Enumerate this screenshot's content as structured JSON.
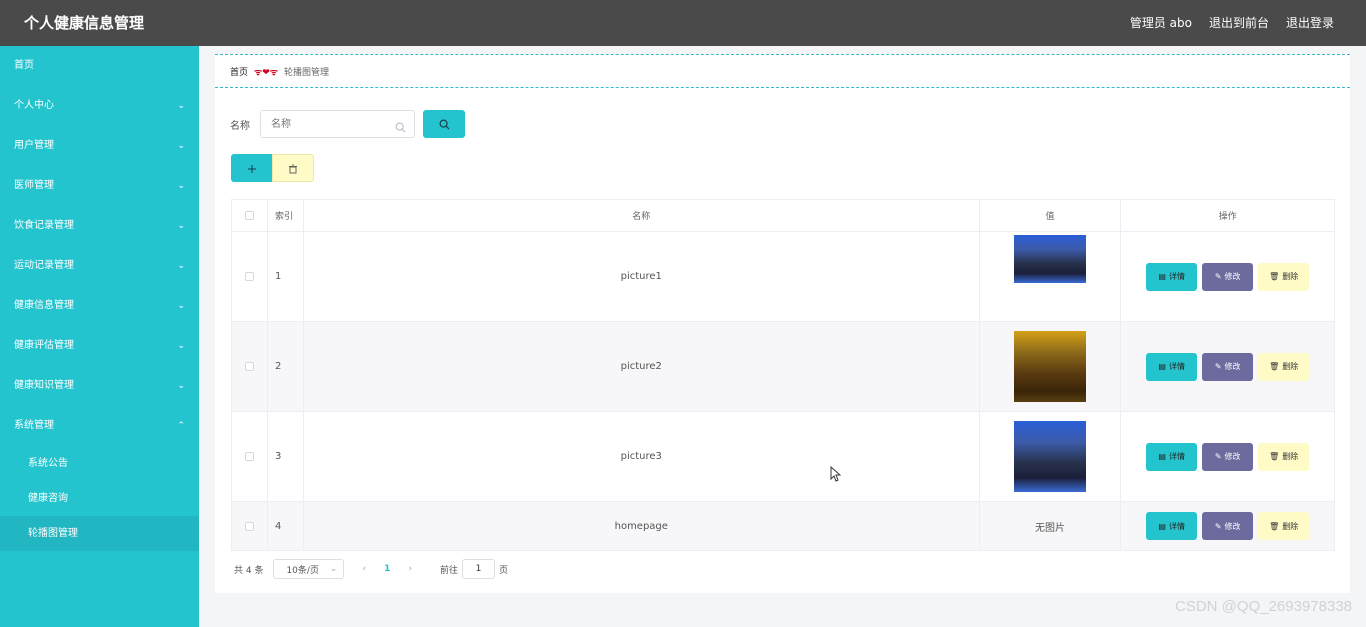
{
  "header": {
    "title": "个人健康信息管理",
    "user": "管理员 abo",
    "front_link": "退出到前台",
    "logout": "退出登录"
  },
  "sidebar": {
    "items": [
      {
        "label": "首页",
        "expandable": false
      },
      {
        "label": "个人中心",
        "expandable": true
      },
      {
        "label": "用户管理",
        "expandable": true
      },
      {
        "label": "医师管理",
        "expandable": true
      },
      {
        "label": "饮食记录管理",
        "expandable": true
      },
      {
        "label": "运动记录管理",
        "expandable": true
      },
      {
        "label": "健康信息管理",
        "expandable": true
      },
      {
        "label": "健康评估管理",
        "expandable": true
      },
      {
        "label": "健康知识管理",
        "expandable": true
      },
      {
        "label": "系统管理",
        "expandable": true,
        "expanded": true
      }
    ],
    "subitems": [
      {
        "label": "系统公告"
      },
      {
        "label": "健康咨询"
      },
      {
        "label": "轮播图管理",
        "active": true
      }
    ]
  },
  "breadcrumb": {
    "home": "首页",
    "separator": "ᯤ❤ᯤ",
    "current": "轮播图管理"
  },
  "search": {
    "label": "名称",
    "placeholder": "名称",
    "value": ""
  },
  "table": {
    "headers": {
      "index": "索引",
      "name": "名称",
      "value": "值",
      "ops": "操作"
    },
    "rows": [
      {
        "index": "1",
        "name": "picture1",
        "value": "",
        "has_image": true
      },
      {
        "index": "2",
        "name": "picture2",
        "value": "",
        "has_image": true
      },
      {
        "index": "3",
        "name": "picture3",
        "value": "",
        "has_image": true
      },
      {
        "index": "4",
        "name": "homepage",
        "value": "无图片",
        "has_image": false
      }
    ],
    "ops": {
      "detail": "详情",
      "edit": "修改",
      "delete": "删除"
    }
  },
  "pagination": {
    "total": "共 4 条",
    "page_size": "10条/页",
    "current_page": "1",
    "goto_label": "前往",
    "goto_value": "1",
    "goto_unit": "页"
  },
  "watermark": "CSDN @QQ_2693978338",
  "colors": {
    "accent": "#24c4cf",
    "topbar": "#4a4a4a",
    "edit": "#6d6a9e",
    "delete": "#fffbc7"
  }
}
